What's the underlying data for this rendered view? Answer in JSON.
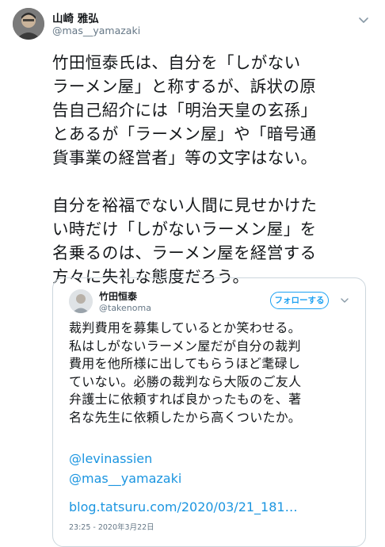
{
  "tweet": {
    "author_name": "山崎 雅弘",
    "author_handle": "@mas__yamazaki",
    "avatar_icon": "user-avatar-photo",
    "menu_icon": "chevron-down-icon",
    "text": "竹田恒泰氏は、自分を「しがない\nラーメン屋」と称するが、訴状の原\n告自己紹介には「明治天皇の玄孫」\nとあるが「ラーメン屋」や「暗号通\n貨事業の経営者」等の文字はない。\n\n自分を裕福でない人間に見せかけた\nい時だけ「しがないラーメン屋」を\n名乗るのは、ラーメン屋を経営する\n方々に失礼な態度だろう。"
  },
  "quoted_tweet": {
    "author_name": "竹田恒泰",
    "author_handle": "@takenoma",
    "follow_label": "フォローする",
    "text": "裁判費用を募集しているとか笑わせる。\n私はしがないラーメン屋だが自分の裁判\n費用を他所様に出してもらうほど耄碌し\nていない。必勝の裁判なら大阪のご友人\n弁護士に依頼すれば良かったものを、著\n名な先生に依頼したから高くついたか。",
    "mention_1": "@levinassien",
    "mention_2": "@mas__yamazaki",
    "link": "blog.tatsuru.com/2020/03/21_181…",
    "timestamp": "23:25 - 2020年3月22日"
  },
  "colors": {
    "text": "#14171a",
    "secondary": "#657786",
    "link": "#1b95e0",
    "accent": "#1da1f2",
    "border": "#ccd6dd"
  }
}
